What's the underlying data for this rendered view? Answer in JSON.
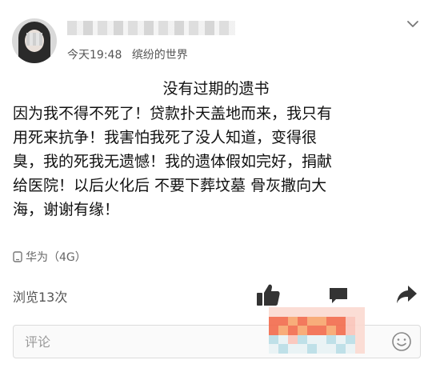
{
  "header": {
    "time": "今天19:48",
    "source": "缤纷的世界"
  },
  "post": {
    "title": "没有过期的遗书",
    "lines": [
      "因为我不得不死了！贷款扑天盖地而来，我只有",
      "用死来抗争！我害怕我死了没人知道，变得很",
      "臭，我的死我无遗憾！我的遗体假如完好，捐献",
      "给医院！以后火化后 不要下葬坟墓  骨灰撒向大",
      "海，谢谢有缘！"
    ]
  },
  "device": {
    "label": "华为（4G）",
    "icon": "phone-icon"
  },
  "stats": {
    "views": "浏览13次"
  },
  "comment": {
    "placeholder": "评论"
  },
  "colors": {
    "text": "#111111",
    "meta": "#555555",
    "icon": "#333333",
    "redact": [
      "#f26a4b",
      "#f7a46b",
      "#f9c3b8",
      "#b8dde6",
      "#e8f2f4",
      "#fbd9d0"
    ]
  }
}
